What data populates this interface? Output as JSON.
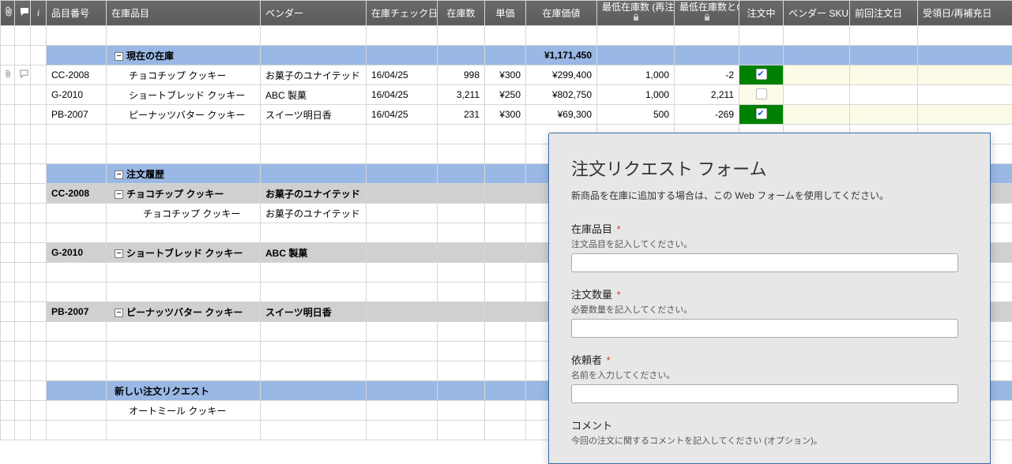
{
  "headers": {
    "attach": "",
    "comment": "",
    "info": "i",
    "item_no": "品目番号",
    "item_name": "在庫品目",
    "vendor": "ベンダー",
    "check_date": "在庫チェック日",
    "qty": "在庫数",
    "unit_price": "単価",
    "value": "在庫価値",
    "reorder_level": "最低在庫数 (再注文レベル)",
    "diff": "最低在庫数との差",
    "ordering": "注文中",
    "vendor_sku": "ベンダー SKU",
    "last_order": "前回注文日",
    "receipt": "受領日/再補充日"
  },
  "sections": {
    "current_stock": "現在の在庫",
    "order_history": "注文履歴",
    "new_request": "新しい注文リクエスト"
  },
  "totals": {
    "value": "¥1,171,450"
  },
  "stock": [
    {
      "item_no": "CC-2008",
      "name": "チョコチップ クッキー",
      "vendor": "お菓子のユナイテッド",
      "date": "16/04/25",
      "qty": "998",
      "unit": "¥300",
      "value": "¥299,400",
      "reorder": "1,000",
      "diff": "-2",
      "ordering": true
    },
    {
      "item_no": "G-2010",
      "name": "ショートブレッド クッキー",
      "vendor": "ABC 製菓",
      "date": "16/04/25",
      "qty": "3,211",
      "unit": "¥250",
      "value": "¥802,750",
      "reorder": "1,000",
      "diff": "2,211",
      "ordering": false
    },
    {
      "item_no": "PB-2007",
      "name": "ピーナッツバター クッキー",
      "vendor": "スイーツ明日香",
      "date": "16/04/25",
      "qty": "231",
      "unit": "¥300",
      "value": "¥69,300",
      "reorder": "500",
      "diff": "-269",
      "ordering": true
    }
  ],
  "history": [
    {
      "item_no": "CC-2008",
      "name": "チョコチップ クッキー",
      "vendor": "お菓子のユナイテッド",
      "child_name": "チョコチップ クッキー",
      "child_vendor": "お菓子のユナイテッド"
    },
    {
      "item_no": "G-2010",
      "name": "ショートブレッド クッキー",
      "vendor": "ABC 製菓"
    },
    {
      "item_no": "PB-2007",
      "name": "ピーナッツバター クッキー",
      "vendor": "スイーツ明日香"
    }
  ],
  "new_request_item": "オートミール クッキー",
  "form": {
    "title": "注文リクエスト フォーム",
    "lead": "新商品を在庫に追加する場合は、この Web フォームを使用してください。",
    "item_label": "在庫品目",
    "item_hint": "注文品目を記入してください。",
    "qty_label": "注文数量",
    "qty_hint": "必要数量を記入してください。",
    "requester_label": "依頼者",
    "requester_hint": "名前を入力してください。",
    "comment_label": "コメント",
    "comment_hint": "今回の注文に関するコメントを記入してください (オプション)。",
    "required_mark": "*"
  }
}
